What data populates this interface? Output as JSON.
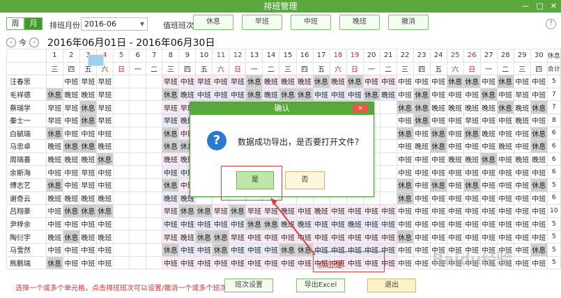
{
  "window": {
    "title": "排班管理",
    "controls": [
      "—",
      "□",
      "✕"
    ]
  },
  "toolbar": {
    "week_label": "周",
    "month_label": "月",
    "month_field_label": "排班月份",
    "month_value": "2016-06",
    "shift_label": "值班班次",
    "shift_buttons": [
      "休息",
      "早班",
      "中班",
      "晚班",
      "撤消"
    ],
    "help": "?"
  },
  "date_nav": {
    "prev": "‹",
    "today": "今",
    "next": "›",
    "range": "2016年06月01日 - 2016年06月30日"
  },
  "grid": {
    "days": [
      "1",
      "2",
      "3",
      "4",
      "5",
      "6",
      "7",
      "8",
      "9",
      "10",
      "11",
      "12",
      "13",
      "14",
      "15",
      "16",
      "17",
      "18",
      "19",
      "20",
      "21",
      "22",
      "23",
      "24",
      "25",
      "26",
      "27",
      "28",
      "29",
      "30"
    ],
    "weekdays": [
      "三",
      "四",
      "五",
      "六",
      "日",
      "一",
      "二",
      "三",
      "四",
      "五",
      "六",
      "日",
      "一",
      "二",
      "三",
      "四",
      "五",
      "六",
      "日",
      "一",
      "二",
      "三",
      "四",
      "五",
      "六",
      "日",
      "一",
      "二",
      "三",
      "四"
    ],
    "total_header": "休息",
    "total_sub": "合计",
    "rows": [
      {
        "name": "汪春思",
        "shifts": [
          "",
          "中班",
          "早班",
          "早班",
          "",
          "",
          "",
          "早班",
          "中班",
          "早班",
          "中班",
          "早班",
          "休息",
          "晚班",
          "晚班",
          "晚班",
          "休息",
          "晚班",
          "休息",
          "中班",
          "中班",
          "中班",
          "中班",
          "中班",
          "休息",
          "休息",
          "中班",
          "休息",
          "中班",
          "中班"
        ],
        "total": "5"
      },
      {
        "name": "毛祥德",
        "shifts": [
          "休息",
          "晚班",
          "晚班",
          "早班",
          "",
          "",
          "",
          "休息",
          "晚班",
          "中班",
          "中班",
          "中班",
          "休息",
          "晚班",
          "休息",
          "休息",
          "中班",
          "中班",
          "中班",
          "休息",
          "晚班",
          "中班",
          "休息",
          "中班",
          "中班",
          "中班",
          "休息",
          "中班",
          "早班",
          "中班"
        ],
        "total": "7"
      },
      {
        "name": "蔡瑞学",
        "shifts": [
          "早班",
          "早班",
          "休息",
          "早班",
          "",
          "",
          "",
          "早班",
          "早班",
          "",
          "",
          "",
          "",
          "",
          "",
          "",
          "",
          "",
          "",
          "",
          "",
          "休息",
          "休息",
          "晚班",
          "晚班",
          "晚班",
          "晚班",
          "休息",
          "晚班",
          "休息"
        ],
        "total": "7"
      },
      {
        "name": "秦士一",
        "shifts": [
          "早班",
          "中班",
          "休息",
          "早班",
          "",
          "",
          "",
          "早班",
          "晚班",
          "",
          "",
          "",
          "",
          "",
          "",
          "",
          "",
          "",
          "",
          "",
          "",
          "中班",
          "休息",
          "中班",
          "中班",
          "早班",
          "中班",
          "中班",
          "晚班",
          "中班"
        ],
        "total": "8"
      },
      {
        "name": "白毓瑞",
        "shifts": [
          "休息",
          "中班",
          "中班",
          "中班",
          "",
          "",
          "",
          "休息",
          "中班",
          "",
          "",
          "",
          "",
          "",
          "",
          "",
          "",
          "",
          "",
          "",
          "",
          "休息",
          "中班",
          "休息",
          "中班",
          "休息",
          "晚班",
          "中班",
          "中班",
          "休息"
        ],
        "total": "6"
      },
      {
        "name": "马忠卓",
        "shifts": [
          "晚班",
          "休息",
          "休息",
          "晚班",
          "",
          "",
          "",
          "休息",
          "休息",
          "",
          "",
          "",
          "",
          "",
          "",
          "",
          "",
          "",
          "",
          "",
          "",
          "中班",
          "晚班",
          "休息",
          "中班",
          "中班",
          "中班",
          "晚班",
          "中班",
          "休息"
        ],
        "total": "6"
      },
      {
        "name": "周瑞善",
        "shifts": [
          "晚班",
          "晚班",
          "晚班",
          "休息",
          "",
          "",
          "",
          "晚班",
          "晚班",
          "",
          "",
          "",
          "",
          "",
          "",
          "",
          "",
          "",
          "",
          "",
          "",
          "中班",
          "中班",
          "中班",
          "晚班",
          "晚班",
          "休息",
          "中班",
          "晚班",
          "晚班"
        ],
        "total": "6"
      },
      {
        "name": "余斯海",
        "shifts": [
          "中班",
          "中班",
          "早班",
          "中班",
          "",
          "",
          "",
          "中班",
          "中班",
          "",
          "",
          "",
          "",
          "",
          "",
          "",
          "",
          "",
          "",
          "",
          "",
          "中班",
          "中班",
          "中班",
          "中班",
          "中班",
          "中班",
          "中班",
          "中班",
          "中班"
        ],
        "total": "6"
      },
      {
        "name": "傅志艺",
        "shifts": [
          "休息",
          "中班",
          "早班",
          "中班",
          "",
          "",
          "",
          "休息",
          "中班",
          "",
          "",
          "",
          "",
          "",
          "",
          "",
          "",
          "",
          "",
          "",
          "",
          "休息",
          "中班",
          "休息",
          "中班",
          "休息",
          "中班",
          "中班",
          "中班",
          "休息"
        ],
        "total": "5"
      },
      {
        "name": "谢奇云",
        "shifts": [
          "晚班",
          "晚班",
          "晚班",
          "晚班",
          "",
          "",
          "",
          "晚班",
          "晚班",
          "",
          "",
          "",
          "",
          "",
          "",
          "",
          "",
          "",
          "",
          "",
          "",
          "休息",
          "中班",
          "中班",
          "中班",
          "中班",
          "中班",
          "中班",
          "中班",
          "中班"
        ],
        "total": "6"
      },
      {
        "name": "吕翔豪",
        "shifts": [
          "中班",
          "休息",
          "休息",
          "休息",
          "",
          "",
          "",
          "早班",
          "休息",
          "休息",
          "早班",
          "休息",
          "早班",
          "早班",
          "晚班",
          "中班",
          "晚班",
          "中班",
          "中班",
          "中班",
          "中班",
          "中班",
          "中班",
          "中班",
          "中班",
          "中班",
          "中班",
          "中班",
          "中班",
          "中班"
        ],
        "total": "10"
      },
      {
        "name": "尹梓余",
        "shifts": [
          "中班",
          "中班",
          "中班",
          "中班",
          "",
          "",
          "",
          "中班",
          "中班",
          "中班",
          "中班",
          "中班",
          "休息",
          "休息",
          "晚班",
          "晚班",
          "中班",
          "中班",
          "晚班",
          "中班",
          "中班",
          "中班",
          "中班",
          "中班",
          "中班",
          "中班",
          "中班",
          "中班",
          "中班",
          "中班"
        ],
        "total": "5"
      },
      {
        "name": "陶衍宇",
        "shifts": [
          "晚班",
          "休息",
          "晚班",
          "晚班",
          "",
          "",
          "",
          "早班",
          "晚班",
          "休息",
          "休息",
          "早班",
          "中班",
          "中班",
          "中班",
          "中班",
          "中班",
          "中班",
          "中班",
          "中班",
          "中班",
          "休息",
          "中班",
          "中班",
          "中班",
          "中班",
          "中班",
          "中班",
          "中班",
          "中班"
        ],
        "total": "5"
      },
      {
        "name": "马雪然",
        "shifts": [
          "中班",
          "中班",
          "中班",
          "中班",
          "",
          "",
          "",
          "休息",
          "中班",
          "中班",
          "休息",
          "中班",
          "中班",
          "中班",
          "休息",
          "休息",
          "中班",
          "中班",
          "中班",
          "中班",
          "中班",
          "中班",
          "中班",
          "中班",
          "中班",
          "中班",
          "中班",
          "中班",
          "中班",
          "休息"
        ],
        "total": "5"
      },
      {
        "name": "熊鹏瑞",
        "shifts": [
          "休息",
          "中班",
          "中班",
          "中班",
          "",
          "",
          "",
          "中班",
          "中班",
          "中班",
          "中班",
          "中班",
          "中班",
          "中班",
          "中班",
          "中班",
          "中班",
          "中班",
          "中班",
          "中班",
          "中班",
          "中班",
          "中班",
          "中班",
          "中班",
          "中班",
          "中班",
          "中班",
          "中班",
          "中班"
        ],
        "total": "5"
      }
    ]
  },
  "dialog": {
    "title": "确认",
    "close": "✕",
    "icon": "question-icon",
    "message": "数据成功导出，是否要打开文件?",
    "yes": "是",
    "no": "否"
  },
  "annotation": "点击是",
  "footer": {
    "hint": "选择一个或多个单元格，点击排班班次可以设置/撤消一个或多个班次",
    "shift_settings": "班次设置",
    "export_excel": "导出Excel",
    "exit": "退出"
  },
  "watermark": "Baidu经验",
  "colors": {
    "accent": "#5aa83c",
    "rest": "#cfcfcf",
    "weekend": "#d02020",
    "annotation": "#d84040"
  }
}
